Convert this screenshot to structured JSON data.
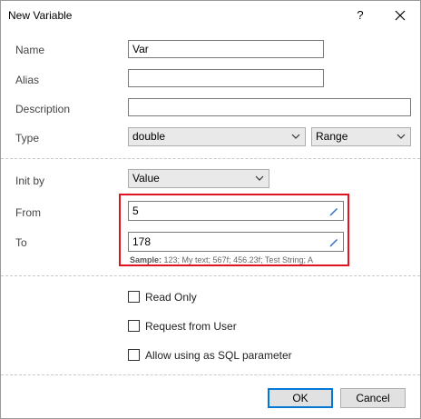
{
  "dialog": {
    "title": "New Variable",
    "help_glyph": "?",
    "close_icon": "close-icon"
  },
  "form": {
    "name_label": "Name",
    "name_value": "Var",
    "alias_label": "Alias",
    "alias_value": "",
    "description_label": "Description",
    "description_value": "",
    "type_label": "Type",
    "type_value": "double",
    "type_mode_value": "Range",
    "init_by_label": "Init by",
    "init_by_value": "Value",
    "from_label": "From",
    "from_value": "5",
    "to_label": "To",
    "to_value": "178",
    "sample_label": "Sample:",
    "sample_text": "123; My text; 567f; 456.23f; Test String; A"
  },
  "options": {
    "read_only_label": "Read Only",
    "read_only_checked": false,
    "request_from_user_label": "Request from User",
    "request_from_user_checked": false,
    "sql_param_label": "Allow using as SQL parameter",
    "sql_param_checked": false
  },
  "buttons": {
    "ok_label": "OK",
    "cancel_label": "Cancel"
  },
  "colors": {
    "highlight": "#e0141e",
    "default_button_border": "#0078d7"
  }
}
